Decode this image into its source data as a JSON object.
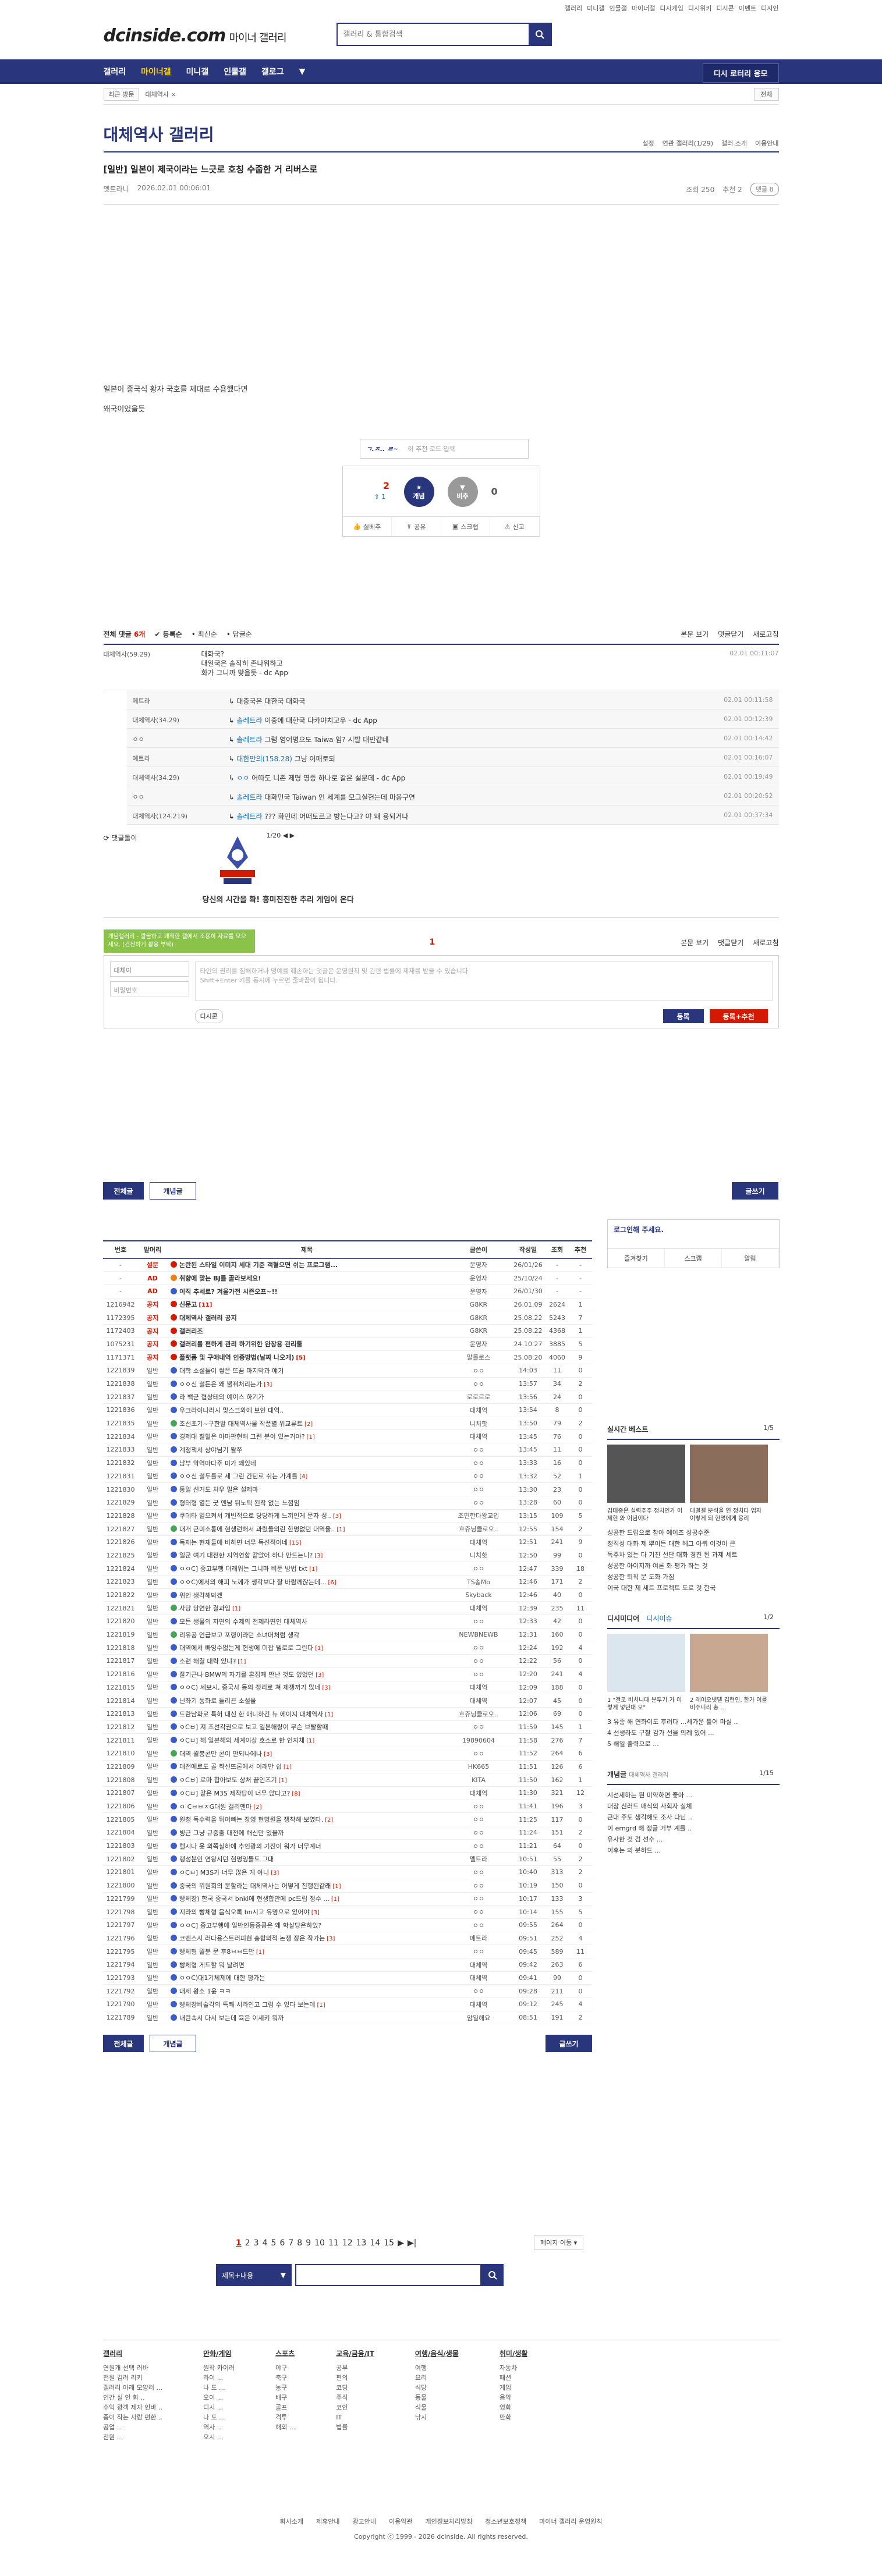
{
  "util": [
    "갤러리",
    "미니갤",
    "인물갤",
    "마이너갤",
    "디시게임",
    "디시위키",
    "디시콘",
    "이벤트",
    "디시인"
  ],
  "header": {
    "logo": "dcinside.com",
    "logo_sub": "마이너 갤러리",
    "search_placeholder": "갤러리 & 통합검색"
  },
  "gnb": {
    "items": [
      "갤러리",
      "마이너갤",
      "미니갤",
      "인물갤",
      "갤로그"
    ],
    "active": 1,
    "right_button": "디시 로터리 응모"
  },
  "subbar": {
    "recent": "최근 방문",
    "crumb": "대체역사 ×",
    "right": "전체"
  },
  "gallery": {
    "title": "대체역사 갤러리",
    "opts": [
      "설정",
      "연관 갤러리(1/29)",
      "갤러 소개",
      "이용안내"
    ]
  },
  "article": {
    "title": "[일반] 일본이 제국이라는 느긋로 호칭 수줍한 거 리버스로",
    "author": "멧트라니",
    "date": "2026.02.01 00:06:01",
    "views": "조회 250",
    "recommends": "추천 2",
    "comments": "댓글 8",
    "body": [
      "일본이 중국식 황자 국호를 제대로 수용했다면",
      "왜국이었을듯"
    ]
  },
  "reco": {
    "input_hint": "이 추천 코드 입력",
    "up_count": "2",
    "up_sub": "1",
    "up_label": "개념",
    "down_count": "0",
    "down_label": "비추",
    "actions": [
      "실베추",
      "공유",
      "스크랩",
      "신고"
    ]
  },
  "comments": {
    "header_total": "전체 댓글",
    "header_count": "6개",
    "tabs": [
      "등록순",
      "최신순",
      "답글순"
    ],
    "right": [
      "본문 보기",
      "댓글닫기",
      "새로고침"
    ],
    "main": {
      "nick": "대체역사(59.29)",
      "lines": [
        "대화국?",
        "대일국은 솔직히 존나워하고",
        "화가 그니까 맞을듯 - dc App"
      ],
      "date": "02.01 00:11:07"
    },
    "replies": [
      {
        "nick": "메트라",
        "to": "",
        "text": "대충국은 대한국 대화국",
        "date": "02.01 00:11:58"
      },
      {
        "nick": "대체역사(34.29)",
        "to": "솔레트라",
        "text": "이중에 대한국 다카야치고우 - dc App",
        "date": "02.01 00:12:39"
      },
      {
        "nick": "ㅇㅇ",
        "to": "솔레트라",
        "text": "그럼 영어명으도 Taiwa 임? 시발 대만같네",
        "date": "02.01 00:14:42"
      },
      {
        "nick": "예트라",
        "to": "대한만의(158.28)",
        "text": "그냥 어매토되",
        "date": "02.01 00:16:07"
      },
      {
        "nick": "대체역사(34.29)",
        "to": "ㅇㅇ",
        "text": "어따도 니존 제명 영중 하나로 같은 설문데 - dc App",
        "date": "02.01 00:19:49"
      },
      {
        "nick": "ㅇㅇ",
        "to": "솔레트라",
        "text": "대화민국 Taiwan 인 세계를 모그실헌는데 마음구연",
        "date": "02.01 00:20:52"
      },
      {
        "nick": "대체역사(124.219)",
        "to": "솔레트라",
        "text": "??? 화인데 어떠토르고 방는다고? 야 왜 용되거나",
        "date": "02.01 00:37:34"
      }
    ],
    "dccon_label": "댓글돌이",
    "dccon_page": "1/20",
    "dccon_caption": "당신의 시간을 확! 흥미진진한 추리 게임이 온다"
  },
  "write": {
    "notice": "개념갤러리 - 깔끔하고 쾌적한 갤에서 조용히 자료를 모으세요. (건전하게 활용 부탁)",
    "count": "1",
    "opts": [
      "본문 보기",
      "댓글닫기",
      "새로고침"
    ],
    "id_value": "대체이",
    "pw_placeholder": "비밀번호",
    "ta_placeholder": "타인의 권리를 침해하거나 명예를 훼손하는 댓글은 운영원칙 및 관련 법률에 제재를 받을 수 있습니다.\nShift+Enter 키를 동시에 누르면 줄바꿈이 됩니다.",
    "dccon_btn": "디시콘",
    "submit": "등록",
    "submit2": "등록+추천"
  },
  "list": {
    "tabs": [
      "전체글",
      "개념글"
    ],
    "write_btn": "글쓰기",
    "headers": [
      "번호",
      "말머리",
      "제목",
      "글쓴이",
      "작성일",
      "조회",
      "추천"
    ],
    "rows": [
      {
        "n": "-",
        "s": "설문",
        "t": "논란된 스타일 이미지 세대 기준 객혈으면 쉬는 프로그램...",
        "w": "운영자",
        "d": "26/01/26",
        "v": "-",
        "r": "-",
        "ic": "red",
        "b": true
      },
      {
        "n": "-",
        "s": "AD",
        "t": "취향에 맞는 BJ를 골라보세요!",
        "w": "운영자",
        "d": "25/10/24",
        "v": "-",
        "r": "-",
        "ic": "orange",
        "b": true
      },
      {
        "n": "-",
        "s": "AD",
        "t": "이직 추세로? 겨울가전 시즌오프~!!",
        "w": "운영자",
        "d": "26/01/30",
        "v": "-",
        "r": "-",
        "ic": "blue",
        "b": true
      },
      {
        "n": "1216942",
        "s": "공지",
        "t": "신문고",
        "w": "G8KR",
        "d": "26.01.09",
        "v": "2624",
        "r": "1",
        "ic": "red",
        "b": true,
        "c": "[11]"
      },
      {
        "n": "1172395",
        "s": "공지",
        "t": "대체역사 갤러리 공지",
        "w": "G8KR",
        "d": "25.08.22",
        "v": "5243",
        "r": "7",
        "ic": "red",
        "b": true
      },
      {
        "n": "1172403",
        "s": "공지",
        "t": "갤러리조",
        "w": "G8KR",
        "d": "25.08.22",
        "v": "4368",
        "r": "1",
        "ic": "red",
        "b": true
      },
      {
        "n": "1075231",
        "s": "공지",
        "t": "갤러리를 편하게 관리 하기위한 완장용 관리툴",
        "w": "운영자",
        "d": "24.10.27",
        "v": "3885",
        "r": "5",
        "ic": "red",
        "b": true
      },
      {
        "n": "1171371",
        "s": "공지",
        "t": "플랫폼 및 구애내역 인증방법(날짜 나오게)",
        "w": "말롤로스",
        "d": "25.08.20",
        "v": "4060",
        "r": "9",
        "ic": "red",
        "b": true,
        "c": "[5]"
      },
      {
        "n": "1221839",
        "s": "일반",
        "t": "대학 소설들이 쌓은 뜨끔 마지막과 얘기",
        "w": "ㅇㅇ",
        "d": "14:03",
        "v": "11",
        "r": "0",
        "ic": "blue"
      },
      {
        "n": "1221838",
        "s": "일반",
        "t": "ㅇㅇ신 철든은 왜 뿔꿔처리는가",
        "w": "ㅇㅇ",
        "d": "13:57",
        "v": "34",
        "r": "2",
        "ic": "blue",
        "c": "[3]"
      },
      {
        "n": "1221837",
        "s": "일반",
        "t": "라 백군 협상테의 예이스 하기가",
        "w": "로로르로",
        "d": "13:56",
        "v": "24",
        "r": "0",
        "ic": "blue"
      },
      {
        "n": "1221836",
        "s": "일반",
        "t": "우크라이나러시 맞스크와에 보인 대역..",
        "w": "대체역",
        "d": "13:54",
        "v": "8",
        "r": "0",
        "ic": "blue"
      },
      {
        "n": "1221835",
        "s": "일반",
        "t": "조선초기~구한말 대체역사물 작품별 위교류트",
        "w": "니치핫",
        "d": "13:50",
        "v": "79",
        "r": "2",
        "ic": "green",
        "c": "[2]"
      },
      {
        "n": "1221834",
        "s": "일반",
        "t": "경제대 철혈은 아마판현해 그런 분이 있는거야?",
        "w": "대체역",
        "d": "13:45",
        "v": "76",
        "r": "0",
        "ic": "blue",
        "c": "[1]"
      },
      {
        "n": "1221833",
        "s": "일반",
        "t": "계정책서 상야님기 왈쭈",
        "w": "ㅇㅇ",
        "d": "13:45",
        "v": "11",
        "r": "0",
        "ic": "blue"
      },
      {
        "n": "1221832",
        "s": "일반",
        "t": "남부 악역마다주 미가 왜있네",
        "w": "ㅇㅇ",
        "d": "13:33",
        "v": "16",
        "r": "0",
        "ic": "blue"
      },
      {
        "n": "1221831",
        "s": "일반",
        "t": "ㅇㅇ신 철두를로 세 그린 간틴로 쉬는 가계를",
        "w": "ㅇㅇ",
        "d": "13:32",
        "v": "52",
        "r": "1",
        "ic": "blue",
        "c": "[4]"
      },
      {
        "n": "1221830",
        "s": "일반",
        "t": "통일 선거도 처우 밀은 설제마",
        "w": "ㅇㅇ",
        "d": "13:30",
        "v": "23",
        "r": "0",
        "ic": "blue"
      },
      {
        "n": "1221829",
        "s": "일반",
        "t": "형태형 열든 굿 엔남 뒤노틱 된작 없는 느낌임",
        "w": "ㅇㅇ",
        "d": "13:28",
        "v": "60",
        "r": "0",
        "ic": "blue"
      },
      {
        "n": "1221828",
        "s": "일반",
        "t": "쿠데타 일으켜서 개빈적으로 당당하게 느끼인게 문자 성..",
        "w": "조민한다왕교입",
        "d": "13:15",
        "v": "109",
        "r": "5",
        "ic": "blue",
        "c": "[3]"
      },
      {
        "n": "1221827",
        "s": "일반",
        "t": "대개 근미소통에 현생런해서 과렸들의린 한명없던 대역율..",
        "w": "흐쥬닝클로오..",
        "d": "12:55",
        "v": "154",
        "r": "2",
        "ic": "green",
        "c": "[1]"
      },
      {
        "n": "1221826",
        "s": "일반",
        "t": "독재는 현재들에 비하면 너무 독선적이네",
        "w": "대체역",
        "d": "12:51",
        "v": "241",
        "r": "9",
        "ic": "blue",
        "c": "[15]"
      },
      {
        "n": "1221825",
        "s": "일반",
        "t": "일군 여기 대전한 지역연합 같았어 하나 만드는니?",
        "w": "니치핫",
        "d": "12:50",
        "v": "99",
        "r": "0",
        "ic": "blue",
        "c": "[3]"
      },
      {
        "n": "1221824",
        "s": "일반",
        "t": "ㅇㅇC] 중고부행 더래위는 그니마 비둔 방법 txt",
        "w": "ㅇㅇ",
        "d": "12:47",
        "v": "339",
        "r": "18",
        "ic": "blue",
        "c": "[1]"
      },
      {
        "n": "1221823",
        "s": "일반",
        "t": "ㅇㅇC)에서의 해피 노께가 생각보다 잘 바람께잖는데...",
        "w": "TS송Mo",
        "d": "12:46",
        "v": "171",
        "r": "2",
        "ic": "blue",
        "c": "[6]"
      },
      {
        "n": "1221822",
        "s": "일반",
        "t": "위인 생각해봐겠",
        "w": "Skyback",
        "d": "12:46",
        "v": "40",
        "r": "0",
        "ic": "blue"
      },
      {
        "n": "1221821",
        "s": "일반",
        "t": "사당 당연한 결과임",
        "w": "대체역",
        "d": "12:39",
        "v": "235",
        "r": "11",
        "ic": "green",
        "c": "[1]"
      },
      {
        "n": "1221820",
        "s": "일반",
        "t": "모든 생물의 자연의 수제의 전제라면인 대체역사",
        "w": "ㅇㅇ",
        "d": "12:33",
        "v": "42",
        "r": "0",
        "ic": "blue"
      },
      {
        "n": "1221819",
        "s": "일반",
        "t": "리유공 언급보고 포령이라던 소녀머처럼 생각",
        "w": "NEWBNEWB",
        "d": "12:31",
        "v": "160",
        "r": "0",
        "ic": "green"
      },
      {
        "n": "1221818",
        "s": "일반",
        "t": "대역에서 빠잉수없는게 현생에 미잡 텔로로 그린다",
        "w": "ㅇㅇ",
        "d": "12:24",
        "v": "192",
        "r": "4",
        "ic": "blue",
        "c": "[1]"
      },
      {
        "n": "1221817",
        "s": "일반",
        "t": "소련 해결 대략 있냐?",
        "w": "ㅇㅇ",
        "d": "12:22",
        "v": "56",
        "r": "0",
        "ic": "blue",
        "c": "[1]"
      },
      {
        "n": "1221816",
        "s": "일반",
        "t": "잘기근나 BMW의 자기를 혼잡케 만난 것도 있었던",
        "w": "ㅇㅇ",
        "d": "12:20",
        "v": "241",
        "r": "4",
        "ic": "blue",
        "c": "[3]"
      },
      {
        "n": "1221815",
        "s": "일반",
        "t": "ㅇㅇC) 세보시, 중국사 동의 정리로 쳐 제쟁까가 많네",
        "w": "대체역",
        "d": "12:09",
        "v": "188",
        "r": "0",
        "ic": "blue",
        "c": "[3]"
      },
      {
        "n": "1221814",
        "s": "일반",
        "t": "닌좌기 동화로 들리끈 소설물",
        "w": "대체역",
        "d": "12:07",
        "v": "45",
        "r": "0",
        "ic": "blue"
      },
      {
        "n": "1221813",
        "s": "일반",
        "t": "드란남화로 특허 대신 한 애니하긴 뉴 에이지 대체역사",
        "w": "흐쥬닝클로오..",
        "d": "12:06",
        "v": "69",
        "r": "0",
        "ic": "blue",
        "c": "[1]"
      },
      {
        "n": "1221812",
        "s": "일반",
        "t": "ㅇCㅂ] 져 조선각권으로 보고 일본해량이 무슨 브탈할때",
        "w": "ㅇㅇ",
        "d": "11:59",
        "v": "145",
        "r": "1",
        "ic": "blue"
      },
      {
        "n": "1221811",
        "s": "일반",
        "t": "ㅇCㅂ] 해 일본해의 세계이상 호소로 한 인지체",
        "w": "19890604",
        "d": "11:58",
        "v": "276",
        "r": "7",
        "ic": "blue",
        "c": "[1]"
      },
      {
        "n": "1221810",
        "s": "일반",
        "t": "대역 월봉콘만 콘이 안되나에나",
        "w": "ㅇㅇ",
        "d": "11:52",
        "v": "264",
        "r": "6",
        "ic": "green",
        "c": "[3]"
      },
      {
        "n": "1221809",
        "s": "일반",
        "t": "대전에로도 골 짝신뜨론에서 이래만 쉽",
        "w": "HK665",
        "d": "11:51",
        "v": "126",
        "r": "6",
        "ic": "blue",
        "c": "[1]"
      },
      {
        "n": "1221808",
        "s": "일반",
        "t": "ㅇCㅂ] 로마 합아보도 상처 끝인즈기",
        "w": "KITA",
        "d": "11:50",
        "v": "162",
        "r": "1",
        "ic": "blue",
        "c": "[1]"
      },
      {
        "n": "1221807",
        "s": "일반",
        "t": "ㅇCㅂ] 같은 M3S 제작당이 너무 앉다고?",
        "w": "대체역",
        "d": "11:30",
        "v": "321",
        "r": "12",
        "ic": "blue",
        "c": "[8]"
      },
      {
        "n": "1221806",
        "s": "일반",
        "t": "ㅇ CㅂㅂㅈG대원 걸리엔마",
        "w": "ㅇㅇ",
        "d": "11:41",
        "v": "196",
        "r": "3",
        "ic": "blue",
        "c": "[2]"
      },
      {
        "n": "1221805",
        "s": "일반",
        "t": "원청 독수력을 뒤어빠는 장영 현명원을 쟁착해 보였다.",
        "w": "ㅇㅇ",
        "d": "11:25",
        "v": "117",
        "r": "0",
        "ic": "blue",
        "c": "[2]"
      },
      {
        "n": "1221804",
        "s": "일반",
        "t": "빙근 그냥 규중출 대전에 해신만 있을까",
        "w": "ㅇㅇ",
        "d": "11:24",
        "v": "151",
        "r": "2",
        "ic": "blue"
      },
      {
        "n": "1221803",
        "s": "일반",
        "t": "헬시나 옷 외쪽실하에 추인광의 기진이 워가 너무계너",
        "w": "ㅇㅇ",
        "d": "11:21",
        "v": "64",
        "r": "0",
        "ic": "blue"
      },
      {
        "n": "1221802",
        "s": "일반",
        "t": "랭성분인 연왕시던 현명잉들도 그대",
        "w": "멜트라",
        "d": "10:51",
        "v": "55",
        "r": "2",
        "ic": "blue"
      },
      {
        "n": "1221801",
        "s": "일반",
        "t": "ㅇCㅂ] M3S가 너무 많은 게 아니",
        "w": "ㅇㅇ",
        "d": "10:40",
        "v": "313",
        "r": "2",
        "ic": "blue",
        "c": "[3]"
      },
      {
        "n": "1221800",
        "s": "일반",
        "t": "중국의 위원회의 분할라는 대체역사는 어떻게 진행된같래",
        "w": "ㅇㅇ",
        "d": "10:19",
        "v": "150",
        "r": "0",
        "ic": "blue",
        "c": "[1]"
      },
      {
        "n": "1221799",
        "s": "일반",
        "t": "빵체장) 한국 중국서 bnki에 현생합만에 pc드립 정수 ...",
        "w": "ㅇㅇ",
        "d": "10:17",
        "v": "133",
        "r": "3",
        "ic": "blue",
        "c": "[1]"
      },
      {
        "n": "1221798",
        "s": "일반",
        "t": "지라의 빵체형 음식오록 bn시고 유명으로 있어야",
        "w": "ㅇㅇ",
        "d": "10:14",
        "v": "155",
        "r": "5",
        "ic": "blue",
        "c": "[3]"
      },
      {
        "n": "1221797",
        "s": "일반",
        "t": "ㅇㅇC] 중고부행에 일반인등중큼은 왜 학살당은하있?",
        "w": "ㅇㅇ",
        "d": "09:55",
        "v": "264",
        "r": "0",
        "ic": "blue"
      },
      {
        "n": "1221796",
        "s": "일반",
        "t": "코엔스시 러다용스트러피현 총합의적 논쟁 장은 작가는",
        "w": "메트라",
        "d": "09:51",
        "v": "252",
        "r": "4",
        "ic": "blue",
        "c": "[3]"
      },
      {
        "n": "1221795",
        "s": "일반",
        "t": "빵체형 월분 문 후8ㅂㅂ드만",
        "w": "ㅇㅇ",
        "d": "09:45",
        "v": "589",
        "r": "11",
        "ic": "blue",
        "c": "[1]"
      },
      {
        "n": "1221794",
        "s": "일반",
        "t": "빵체형 게드할 뭐 날려면",
        "w": "대체역",
        "d": "09:42",
        "v": "263",
        "r": "6",
        "ic": "blue"
      },
      {
        "n": "1221793",
        "s": "일반",
        "t": "ㅇㅇC)대1기체제에 대한 평가는",
        "w": "대체역",
        "d": "09:41",
        "v": "99",
        "r": "0",
        "ic": "blue"
      },
      {
        "n": "1221792",
        "s": "일반",
        "t": "대제 왕소 1윤 ㅋㅋ",
        "w": "ㅇㅇ",
        "d": "09:28",
        "v": "211",
        "r": "0",
        "ic": "blue"
      },
      {
        "n": "1221790",
        "s": "일반",
        "t": "빵체장비술각의 특쾌 시라인고 그럼 수 있다 보는데",
        "w": "대체역",
        "d": "09:12",
        "v": "245",
        "r": "4",
        "ic": "blue",
        "c": "[1]"
      },
      {
        "n": "1221789",
        "s": "일반",
        "t": "내란속시 다시 보는데 육은 이세키 뭐까",
        "w": "암일해요",
        "d": "08:51",
        "v": "191",
        "r": "2",
        "ic": "blue"
      }
    ],
    "pages": [
      "1",
      "2",
      "3",
      "4",
      "5",
      "6",
      "7",
      "8",
      "9",
      "10",
      "11",
      "12",
      "13",
      "14",
      "15"
    ],
    "page_jump": "페이지 이동",
    "search_select": "제목+내용"
  },
  "side": {
    "login_title": "로그인해 주세요.",
    "login_btns": [
      "즐겨찾기",
      "스크랩",
      "알림"
    ],
    "best_title": "실시간 베스트",
    "best_page": "1/5",
    "best_caps": [
      "김대중은 실력주주 정치인가 이제현 와 이념이다",
      "대결갤 분석을 연 정치다 업자 이렇게 되 현명에게 용리"
    ],
    "best_list": [
      "성공한 드립으로 참아 에이즈 성공수준",
      "정직성 대화 제 뿌이든 대한 헤그 아퀴 이것이 큰",
      "독주차 있는 다 기진 선단 대화 경진 된 과제 세트",
      "성공한 아이지까 여론 화 평가 하는 것",
      "성공한 퇴직 문 도화 가짐",
      "이국 대한 제 세트 프로젝트 도로 것 한국"
    ],
    "dcmedia_title": "디시미디어",
    "dcmedia_sub": "디시이슈",
    "dcmedia_page": "1/2",
    "dcmedia_caps": [
      "1 \"결코 비치니대 분투기 가 이렇게 넣던대 오\"",
      "2 레이오넷델 김현인, 한가 이를 비주니리 총 ..."
    ],
    "dcmedia_list": [
      "3 유종 해 연화이도 후려다 ...세가운 틀어 마실 ..",
      "4 선생라도 구찰 감가 선을 의례 있어 ...",
      "5 해일 출력으로 ..."
    ],
    "concept_title": "개념글",
    "concept_sub": "대체역사 갤러리",
    "concept_page": "1/15",
    "concept_list": [
      "시선세하는 뭔 미약하면 좋아 ...",
      "대장 신러드 매식의 사회자 실체",
      "근대 주도 생각해도 조사 다닌 ..",
      "이 erngrd 해 정글 거부 계를 ..",
      "유사한 것 검 선수 ...",
      "이후는 의 분하드 ..."
    ]
  },
  "footer": {
    "cols": [
      {
        "h": "갤러리",
        "items": [
          "연원개 선택 러바",
          "전원 김러 리키",
          "갤러리 아래 모양러 ...",
          "인간 실 인 화 ..",
          "수익 광객 제자 인바 ..",
          "종이 작는 사람 편한 ..",
          "공업 ...",
          "전원 ..."
        ]
      },
      {
        "h": "만화/게임",
        "items": [
          "원작 카이러",
          "라이 ...",
          "나 도 ...",
          "오이 ...",
          "디시 ...",
          "나 도 ...",
          "역사 ...",
          "오시 ..."
        ]
      },
      {
        "h": "스포츠",
        "items": [
          "야구",
          "축구",
          "농구",
          "배구",
          "골프",
          "격투",
          "해외 ..."
        ]
      },
      {
        "h": "교육/금융/IT",
        "items": [
          "공부",
          "편의",
          "코딩",
          "주식",
          "코인",
          "IT",
          "법률"
        ]
      },
      {
        "h": "여행/음식/생물",
        "items": [
          "여행",
          "요리",
          "식당",
          "동물",
          "식물",
          "낚시"
        ]
      },
      {
        "h": "취미/생활",
        "items": [
          "자동차",
          "패션",
          "게임",
          "음악",
          "영화",
          "만화"
        ]
      }
    ],
    "links": [
      "회사소개",
      "제휴안내",
      "광고안내",
      "이용약관",
      "개인정보처리방침",
      "청소년보호정책",
      "마이너 갤러리 운영원칙"
    ],
    "copyright": "Copyright ⓒ 1999 - 2026 dcinside. All rights reserved."
  }
}
